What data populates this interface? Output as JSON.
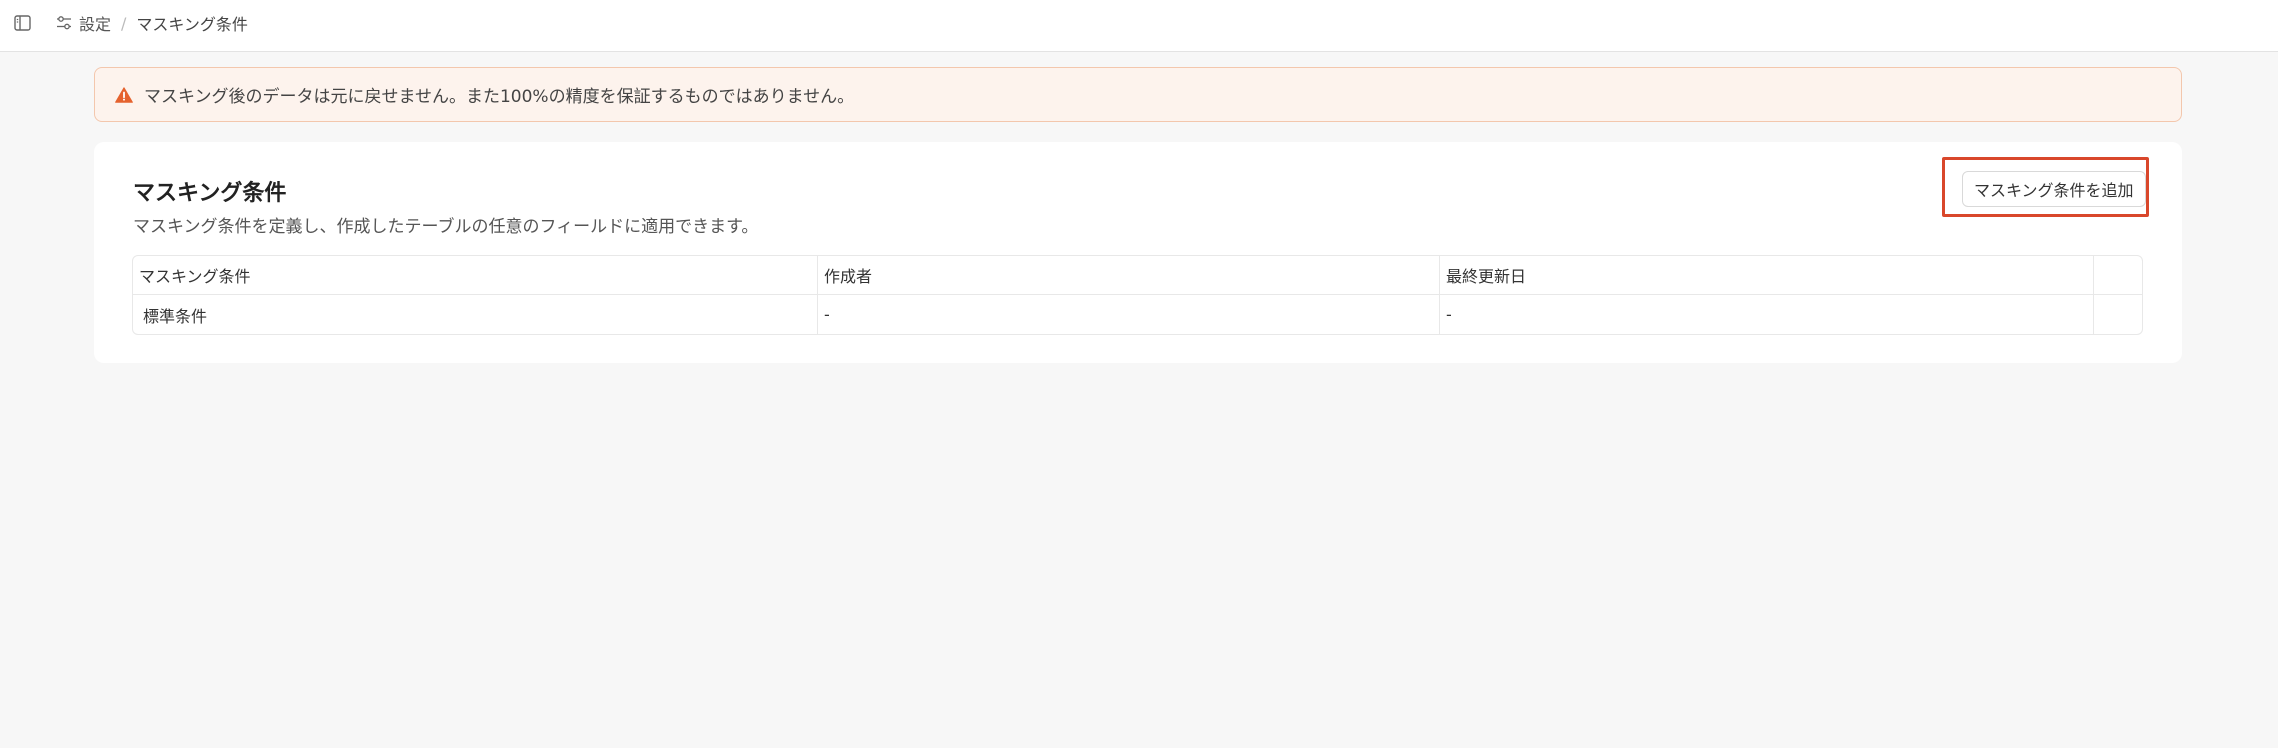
{
  "breadcrumb": {
    "settings_label": "設定",
    "separator": "/",
    "current": "マスキング条件"
  },
  "alert": {
    "text": "マスキング後のデータは元に戻せません。また100%の精度を保証するものではありません。",
    "icon": "warning-icon",
    "color": "#e5622e"
  },
  "card": {
    "title": "マスキング条件",
    "description": "マスキング条件を定義し、作成したテーブルの任意のフィールドに適用できます。",
    "add_button_label": "マスキング条件を追加",
    "highlight_color": "#d9472b"
  },
  "table": {
    "headers": [
      "マスキング条件",
      "作成者",
      "最終更新日",
      ""
    ],
    "rows": [
      [
        "標準条件",
        "-",
        "-",
        ""
      ]
    ]
  },
  "icons": {
    "sidebar_toggle": "sidebar-toggle-icon",
    "settings": "sliders-icon"
  }
}
